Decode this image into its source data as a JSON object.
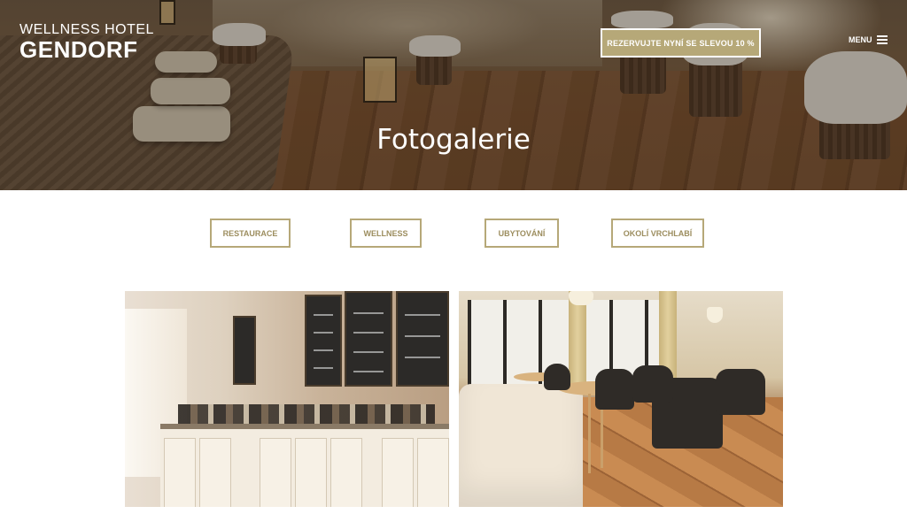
{
  "header": {
    "brand_line1": "WELLNESS HOTEL",
    "brand_line2": "GENDORF",
    "reserve_label": "REZERVUJTE NYNÍ SE SLEVOU 10 %",
    "menu_label": "MENU"
  },
  "hero": {
    "title": "Fotogalerie"
  },
  "filters": [
    {
      "label": "RESTAURACE"
    },
    {
      "label": "WELLNESS"
    },
    {
      "label": "UBYTOVÁNÍ"
    },
    {
      "label": "OKOLÍ VRCHLABÍ"
    }
  ],
  "gallery": [
    {
      "subject": "restaurant buffet with chalkboard menus"
    },
    {
      "subject": "hotel lounge with armchairs and tables"
    }
  ],
  "colors": {
    "accent": "#b6a878",
    "accent_text": "#9c8d5e",
    "hero_overlay": "#3a2a1c"
  },
  "icons": {
    "menu": "hamburger-icon"
  }
}
